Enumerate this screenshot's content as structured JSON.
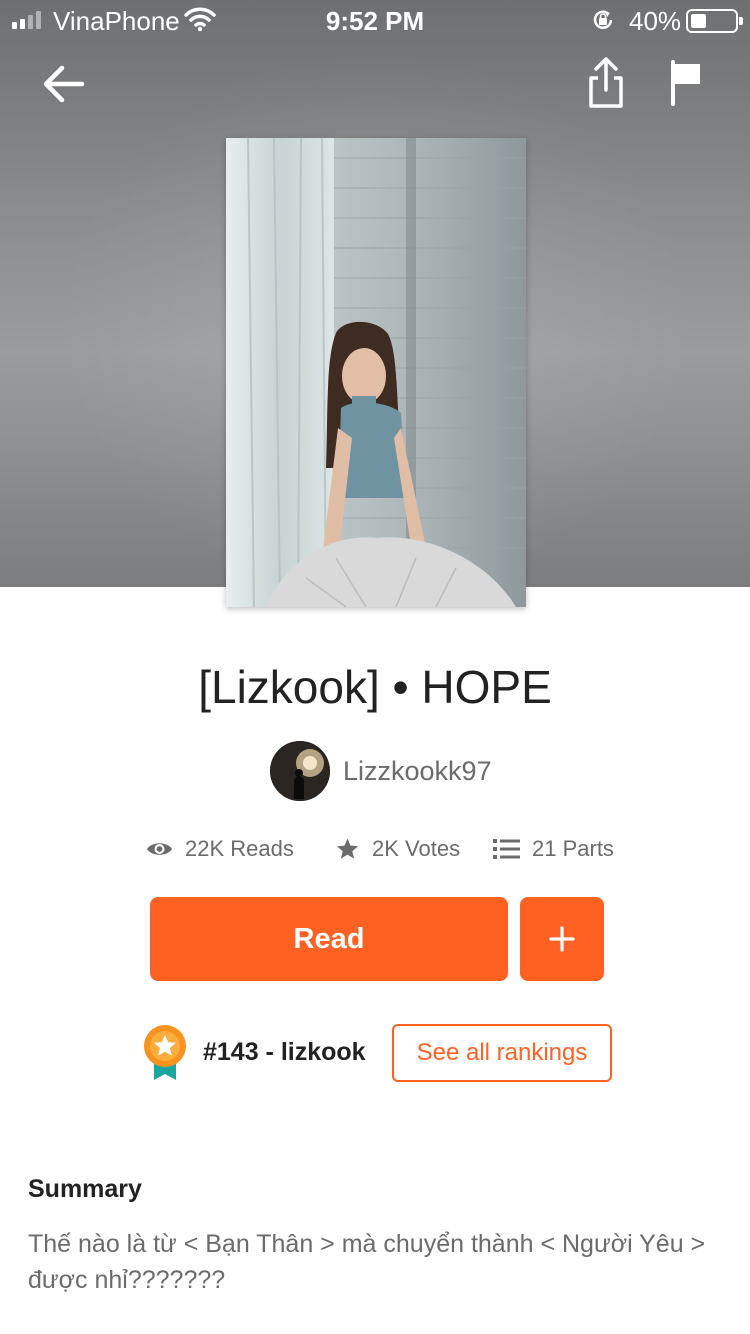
{
  "status_bar": {
    "carrier": "VinaPhone",
    "time": "9:52 PM",
    "battery": "40%",
    "icons": [
      "signal-icon",
      "wifi-icon",
      "orientation-lock-icon",
      "battery-icon"
    ]
  },
  "topbar": {
    "icons": [
      "back-arrow-icon",
      "share-icon",
      "flag-icon"
    ]
  },
  "story": {
    "title": "[Lizkook] • HOPE",
    "author": "Lizzkookk97",
    "stats": {
      "reads": "22K Reads",
      "votes": "2K Votes",
      "parts": "21 Parts"
    }
  },
  "actions": {
    "read_label": "Read",
    "add_label": "+"
  },
  "ranking": {
    "text": "#143 - lizkook",
    "button_label": "See all rankings"
  },
  "summary": {
    "heading": "Summary",
    "text": "Thế nào là từ < Bạn Thân > mà chuyển thành < Người Yêu > được nhỉ???????"
  },
  "colors": {
    "accent": "#ff6122",
    "badge": "#f7931e",
    "ribbon": "#1aa7a1"
  }
}
